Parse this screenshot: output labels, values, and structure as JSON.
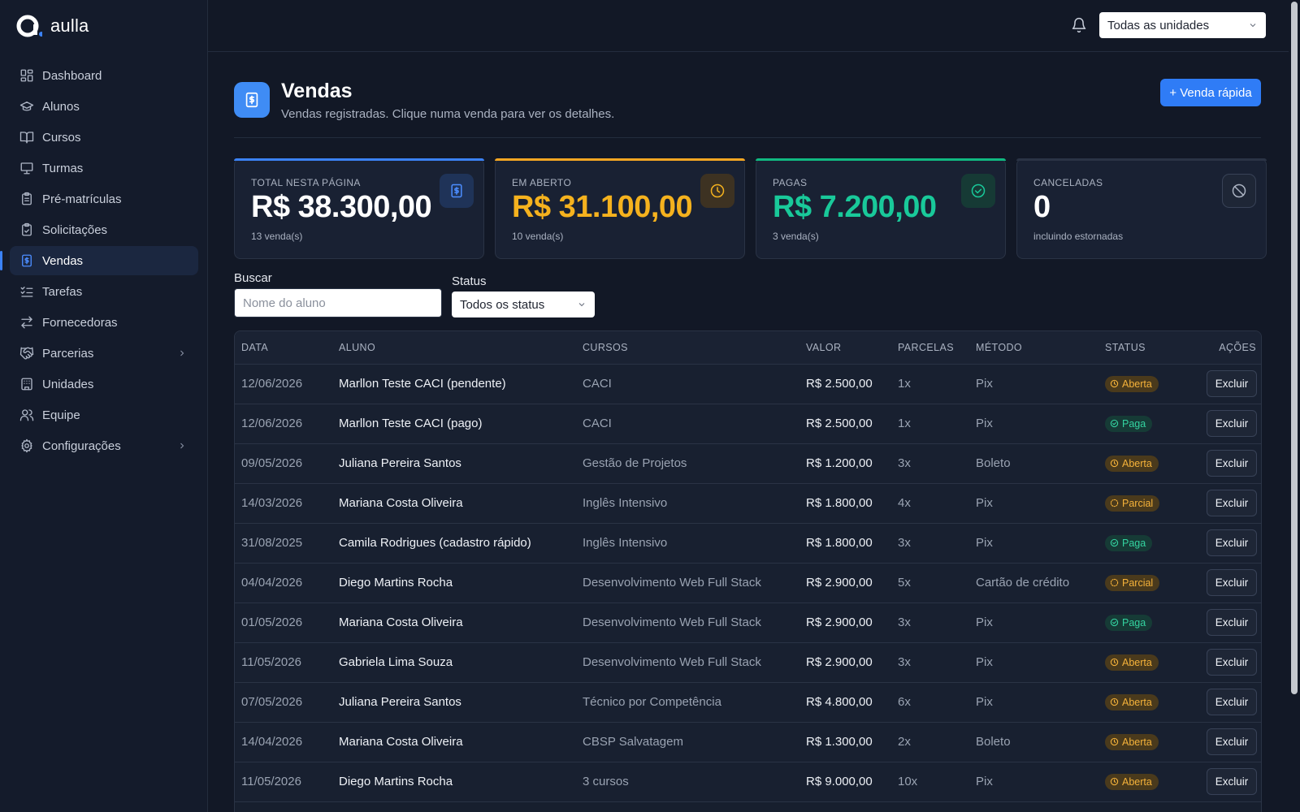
{
  "brand": {
    "name": "aulla"
  },
  "sidebar": {
    "items": [
      {
        "label": "Dashboard",
        "icon": "dashboard-icon",
        "active": false,
        "has_children": false
      },
      {
        "label": "Alunos",
        "icon": "graduation-cap-icon",
        "active": false,
        "has_children": false
      },
      {
        "label": "Cursos",
        "icon": "book-open-icon",
        "active": false,
        "has_children": false
      },
      {
        "label": "Turmas",
        "icon": "presentation-icon",
        "active": false,
        "has_children": false
      },
      {
        "label": "Pré-matrículas",
        "icon": "clipboard-list-icon",
        "active": false,
        "has_children": false
      },
      {
        "label": "Solicitações",
        "icon": "clipboard-check-icon",
        "active": false,
        "has_children": false
      },
      {
        "label": "Vendas",
        "icon": "receipt-dollar-icon",
        "active": true,
        "has_children": false
      },
      {
        "label": "Tarefas",
        "icon": "list-checks-icon",
        "active": false,
        "has_children": false
      },
      {
        "label": "Fornecedoras",
        "icon": "arrows-exchange-icon",
        "active": false,
        "has_children": false
      },
      {
        "label": "Parcerias",
        "icon": "handshake-icon",
        "active": false,
        "has_children": true
      },
      {
        "label": "Unidades",
        "icon": "building-icon",
        "active": false,
        "has_children": false
      },
      {
        "label": "Equipe",
        "icon": "users-icon",
        "active": false,
        "has_children": false
      },
      {
        "label": "Configurações",
        "icon": "gear-icon",
        "active": false,
        "has_children": true
      }
    ]
  },
  "topbar": {
    "unit_select": "Todas as unidades"
  },
  "header": {
    "title": "Vendas",
    "subtitle": "Vendas registradas. Clique numa venda para ver os detalhes.",
    "quick_sale_label": "+ Venda rápida"
  },
  "cards": [
    {
      "label": "TOTAL NESTA PÁGINA",
      "value": "R$ 38.300,00",
      "sub": "13 venda(s)",
      "accent": "#3b82f6",
      "value_color": "#ffffff",
      "icon": "receipt-dollar-icon"
    },
    {
      "label": "EM ABERTO",
      "value": "R$ 31.100,00",
      "sub": "10 venda(s)",
      "accent": "#f5a623",
      "value_color": "#f5b21e",
      "icon": "clock-icon"
    },
    {
      "label": "PAGAS",
      "value": "R$ 7.200,00",
      "sub": "3 venda(s)",
      "accent": "#10b981",
      "value_color": "#19c99a",
      "icon": "check-circle-icon"
    },
    {
      "label": "CANCELADAS",
      "value": "0",
      "sub": "incluindo estornadas",
      "accent": "#2a3345",
      "value_color": "#ffffff",
      "icon": "ban-icon"
    }
  ],
  "filters": {
    "search_label": "Buscar",
    "search_placeholder": "Nome do aluno",
    "status_label": "Status",
    "status_value": "Todos os status"
  },
  "table": {
    "columns": [
      "DATA",
      "ALUNO",
      "CURSOS",
      "VALOR",
      "PARCELAS",
      "MÉTODO",
      "STATUS",
      "AÇÕES"
    ],
    "action_label": "Excluir",
    "rows": [
      {
        "data": "12/06/2026",
        "aluno": "Marllon Teste CACI (pendente)",
        "cursos": "CACI",
        "valor": "R$ 2.500,00",
        "parcelas": "1x",
        "metodo": "Pix",
        "status": "Aberta"
      },
      {
        "data": "12/06/2026",
        "aluno": "Marllon Teste CACI (pago)",
        "cursos": "CACI",
        "valor": "R$ 2.500,00",
        "parcelas": "1x",
        "metodo": "Pix",
        "status": "Paga"
      },
      {
        "data": "09/05/2026",
        "aluno": "Juliana Pereira Santos",
        "cursos": "Gestão de Projetos",
        "valor": "R$ 1.200,00",
        "parcelas": "3x",
        "metodo": "Boleto",
        "status": "Aberta"
      },
      {
        "data": "14/03/2026",
        "aluno": "Mariana Costa Oliveira",
        "cursos": "Inglês Intensivo",
        "valor": "R$ 1.800,00",
        "parcelas": "4x",
        "metodo": "Pix",
        "status": "Parcial"
      },
      {
        "data": "31/08/2025",
        "aluno": "Camila Rodrigues (cadastro rápido)",
        "cursos": "Inglês Intensivo",
        "valor": "R$ 1.800,00",
        "parcelas": "3x",
        "metodo": "Pix",
        "status": "Paga"
      },
      {
        "data": "04/04/2026",
        "aluno": "Diego Martins Rocha",
        "cursos": "Desenvolvimento Web Full Stack",
        "valor": "R$ 2.900,00",
        "parcelas": "5x",
        "metodo": "Cartão de crédito",
        "status": "Parcial"
      },
      {
        "data": "01/05/2026",
        "aluno": "Mariana Costa Oliveira",
        "cursos": "Desenvolvimento Web Full Stack",
        "valor": "R$ 2.900,00",
        "parcelas": "3x",
        "metodo": "Pix",
        "status": "Paga"
      },
      {
        "data": "11/05/2026",
        "aluno": "Gabriela Lima Souza",
        "cursos": "Desenvolvimento Web Full Stack",
        "valor": "R$ 2.900,00",
        "parcelas": "3x",
        "metodo": "Pix",
        "status": "Aberta"
      },
      {
        "data": "07/05/2026",
        "aluno": "Juliana Pereira Santos",
        "cursos": "Técnico por Competência",
        "valor": "R$ 4.800,00",
        "parcelas": "6x",
        "metodo": "Pix",
        "status": "Aberta"
      },
      {
        "data": "14/04/2026",
        "aluno": "Mariana Costa Oliveira",
        "cursos": "CBSP Salvatagem",
        "valor": "R$ 1.300,00",
        "parcelas": "2x",
        "metodo": "Boleto",
        "status": "Aberta"
      },
      {
        "data": "11/05/2026",
        "aluno": "Diego Martins Rocha",
        "cursos": "3 cursos",
        "valor": "R$ 9.000,00",
        "parcelas": "10x",
        "metodo": "Pix",
        "status": "Aberta"
      }
    ]
  }
}
